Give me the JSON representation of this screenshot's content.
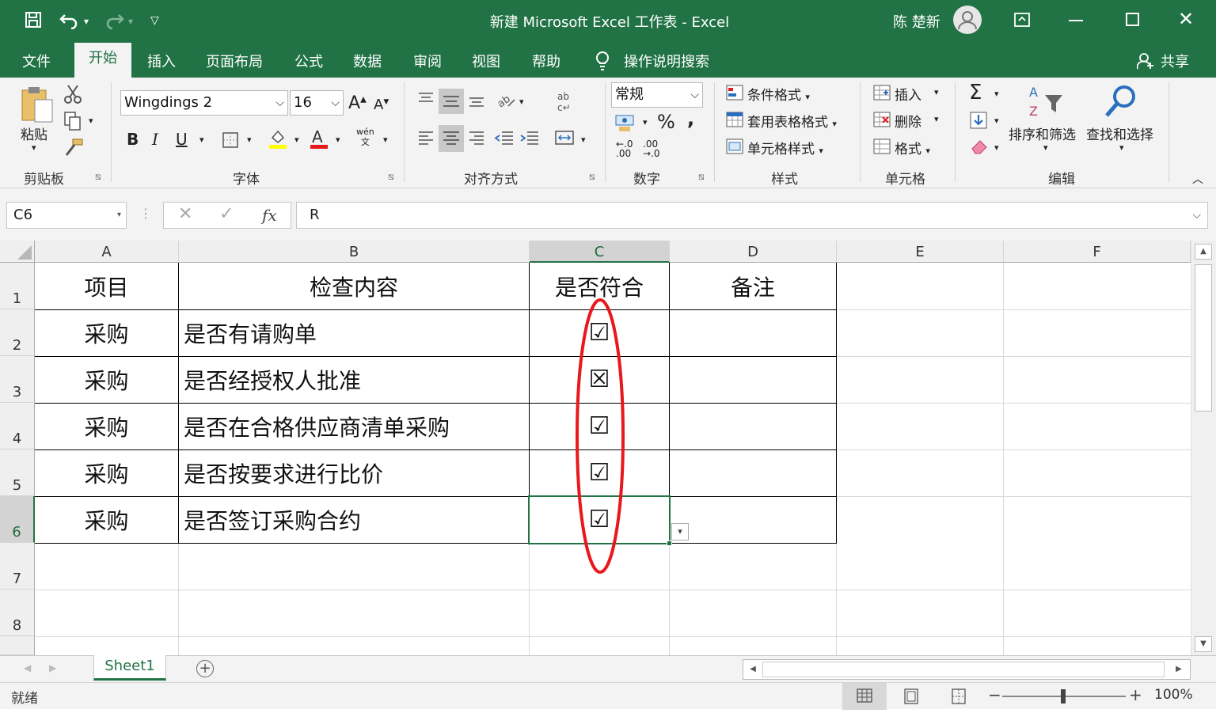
{
  "window": {
    "title": "新建 Microsoft Excel 工作表 - Excel",
    "user": "陈 楚新"
  },
  "tabs": [
    "文件",
    "开始",
    "插入",
    "页面布局",
    "公式",
    "数据",
    "审阅",
    "视图",
    "帮助"
  ],
  "tell_me": "操作说明搜索",
  "share": "共享",
  "ribbon": {
    "paste": "粘贴",
    "font_name": "Wingdings 2",
    "font_size": "16",
    "bold": "B",
    "italic": "I",
    "underline": "U",
    "phonetic": "wén\n文",
    "number_format": "常规",
    "percent": "%",
    "comma": ",",
    "inc_dec": ".0",
    "dec_dec": ".00",
    "cond_format": "条件格式",
    "table_format": "套用表格格式",
    "cell_style": "单元格样式",
    "insert": "插入",
    "delete": "删除",
    "format": "格式",
    "sort_filter": "排序和筛选",
    "find_select": "查找和选择",
    "groups": {
      "clipboard": "剪贴板",
      "font": "字体",
      "alignment": "对齐方式",
      "number": "数字",
      "styles": "样式",
      "cells": "单元格",
      "editing": "编辑"
    }
  },
  "formula_bar": {
    "name_box": "C6",
    "fx": "fx",
    "content": "R"
  },
  "columns": [
    "A",
    "B",
    "C",
    "D",
    "E",
    "F"
  ],
  "rows": [
    "1",
    "2",
    "3",
    "4",
    "5",
    "6",
    "7",
    "8"
  ],
  "table": {
    "header": [
      "项目",
      "检查内容",
      "是否符合",
      "备注"
    ],
    "rows": [
      [
        "采购",
        "是否有请购单",
        "☑",
        ""
      ],
      [
        "采购",
        "是否经授权人批准",
        "☒",
        ""
      ],
      [
        "采购",
        "是否在合格供应商清单采购",
        "☑",
        ""
      ],
      [
        "采购",
        "是否按要求进行比价",
        "☑",
        ""
      ],
      [
        "采购",
        "是否签订采购合约",
        "☑",
        ""
      ]
    ]
  },
  "sheet_tab": "Sheet1",
  "status": {
    "ready": "就绪",
    "zoom": "100%"
  },
  "colors": {
    "excel_green": "#217346",
    "highlight": "#e8181d"
  }
}
